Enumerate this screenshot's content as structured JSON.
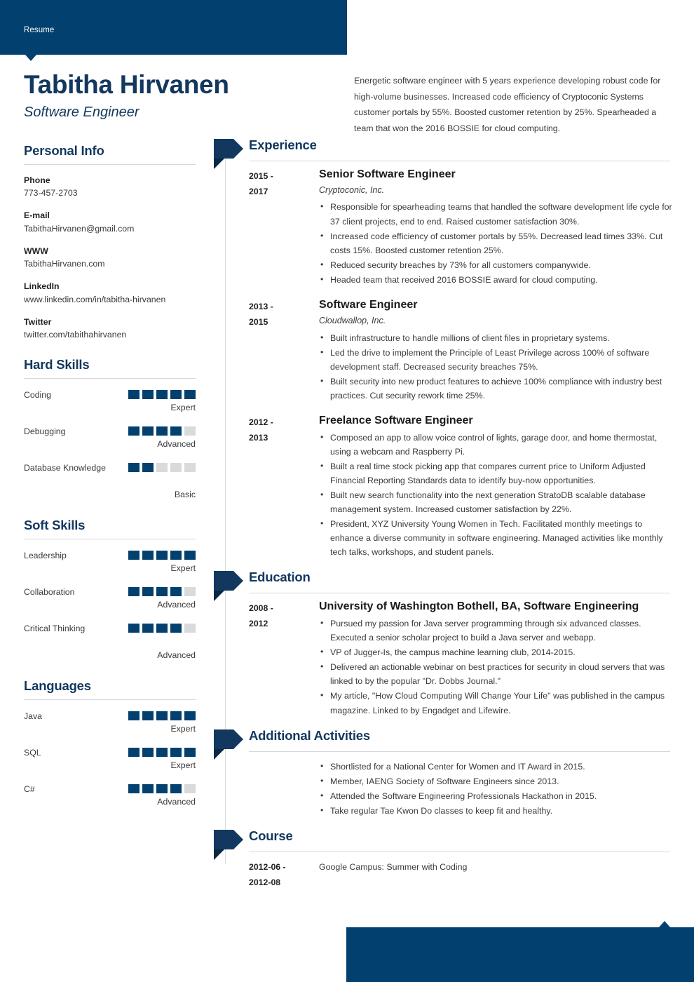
{
  "theme": {
    "primary": "#01406f",
    "heading": "#13385f",
    "fold": "#0a2743",
    "rule": "#d5d7da",
    "dot_off": "#d9dadc"
  },
  "banner": {
    "label": "Resume"
  },
  "header": {
    "name": "Tabitha Hirvanen",
    "job_title": "Software Engineer",
    "summary": "Energetic software engineer with 5 years experience developing robust code for high-volume businesses. Increased code efficiency of Cryptoconic Systems customer portals by 55%. Boosted customer retention by 25%. Spearheaded a team that won the 2016 BOSSIE for cloud computing."
  },
  "sidebar": {
    "personal_info": {
      "heading": "Personal Info",
      "items": [
        {
          "label": "Phone",
          "value": "773-457-2703"
        },
        {
          "label": "E-mail",
          "value": "TabithaHirvanen@gmail.com"
        },
        {
          "label": "WWW",
          "value": "TabithaHirvanen.com"
        },
        {
          "label": "LinkedIn",
          "value": "www.linkedin.com/in/tabitha-hirvanen"
        },
        {
          "label": "Twitter",
          "value": "twitter.com/tabithahirvanen"
        }
      ]
    },
    "hard_skills": {
      "heading": "Hard Skills",
      "max": 5,
      "items": [
        {
          "name": "Coding",
          "rating": 5,
          "level": "Expert"
        },
        {
          "name": "Debugging",
          "rating": 4,
          "level": "Advanced"
        },
        {
          "name": "Database Knowledge",
          "rating": 2,
          "level": "Basic"
        }
      ]
    },
    "soft_skills": {
      "heading": "Soft Skills",
      "max": 5,
      "items": [
        {
          "name": "Leadership",
          "rating": 5,
          "level": "Expert"
        },
        {
          "name": "Collaboration",
          "rating": 4,
          "level": "Advanced"
        },
        {
          "name": "Critical Thinking",
          "rating": 4,
          "level": "Advanced"
        }
      ]
    },
    "languages": {
      "heading": "Languages",
      "max": 5,
      "items": [
        {
          "name": "Java",
          "rating": 5,
          "level": "Expert"
        },
        {
          "name": "SQL",
          "rating": 5,
          "level": "Expert"
        },
        {
          "name": "C#",
          "rating": 4,
          "level": "Advanced"
        }
      ]
    }
  },
  "main": {
    "experience": {
      "heading": "Experience",
      "entries": [
        {
          "date": "2015 - 2017",
          "role": "Senior Software Engineer",
          "company": "Cryptoconic, Inc.",
          "bullets": [
            "Responsible for spearheading teams that handled the software development life cycle for 37 client projects, end to end. Raised customer satisfaction 30%.",
            "Increased code efficiency of customer portals by 55%. Decreased lead times 33%. Cut costs 15%. Boosted customer retention 25%.",
            "Reduced security breaches by 73% for all customers companywide.",
            "Headed team that received 2016 BOSSIE award for cloud computing."
          ]
        },
        {
          "date": "2013 - 2015",
          "role": "Software Engineer",
          "company": "Cloudwallop, Inc.",
          "bullets": [
            "Built infrastructure to handle millions of client files in proprietary systems.",
            "Led the drive to implement the Principle of Least Privilege across 100% of software development staff. Decreased security breaches 75%.",
            "Built security into new product features to achieve 100% compliance with industry best practices. Cut security rework time 25%."
          ]
        },
        {
          "date": "2012 - 2013",
          "role": "Freelance Software Engineer",
          "company": "",
          "bullets": [
            "Composed an app to allow voice control of lights, garage door, and home thermostat, using a webcam and Raspberry Pi.",
            "Built a real time stock picking app that compares current price to Uniform Adjusted Financial Reporting Standards data to identify buy-now opportunities.",
            "Built new search functionality into the next generation StratoDB scalable database management system. Increased customer satisfaction by 22%.",
            "President, XYZ University Young Women in Tech. Facilitated monthly meetings to enhance a diverse community in software engineering. Managed activities like monthly tech talks, workshops, and student panels."
          ]
        }
      ]
    },
    "education": {
      "heading": "Education",
      "entries": [
        {
          "date": "2008 - 2012",
          "role": "University of Washington Bothell, BA, Software Engineering",
          "company": "",
          "bullets": [
            "Pursued my passion for Java server programming through six advanced classes. Executed a senior scholar project to build a Java server and webapp.",
            "VP of Jugger-Is, the campus machine learning club, 2014-2015.",
            "Delivered an actionable webinar on best practices for security in cloud servers that was linked to by the popular \"Dr. Dobbs Journal.\"",
            "My article, \"How Cloud Computing Will Change Your Life\" was published in the campus magazine. Linked to by Engadget and Lifewire."
          ]
        }
      ]
    },
    "additional_activities": {
      "heading": "Additional Activities",
      "entries": [
        {
          "date": "",
          "role": "",
          "company": "",
          "bullets": [
            "Shortlisted for a National Center for Women and IT Award in 2015.",
            "Member, IAENG Society of Software Engineers since 2013.",
            "Attended the Software Engineering Professionals Hackathon in 2015.",
            "Take regular Tae Kwon Do classes to keep fit and healthy."
          ]
        }
      ]
    },
    "course": {
      "heading": "Course",
      "entries": [
        {
          "date": "2012-06 - 2012-08",
          "text": "Google Campus: Summer with Coding"
        }
      ]
    }
  }
}
